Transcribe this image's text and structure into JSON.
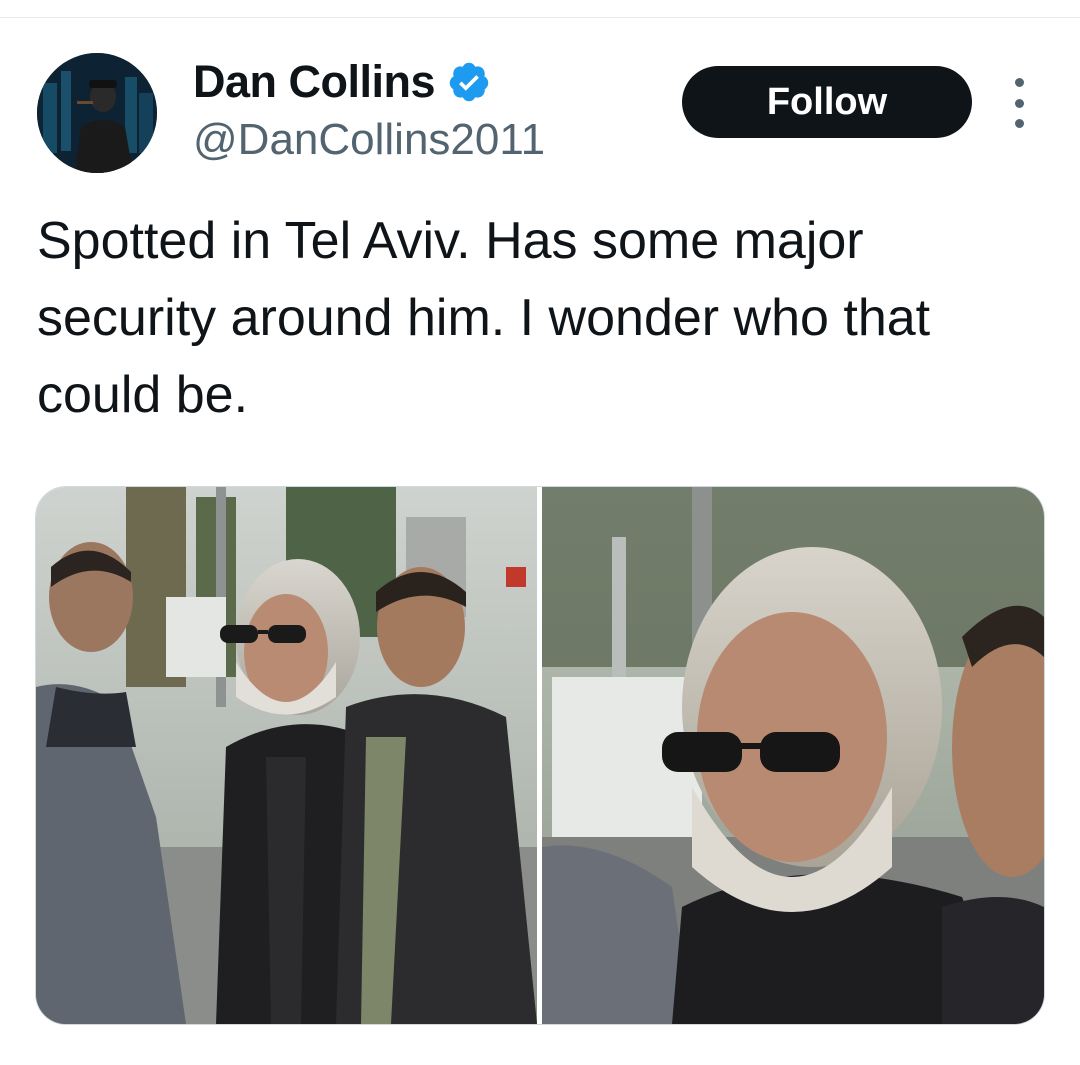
{
  "author": {
    "display_name": "Dan Collins",
    "handle": "@DanCollins2011",
    "avatar_icon": "profile-avatar",
    "verified_icon": "verified-badge-icon",
    "verified_color": "#1d9bf0"
  },
  "actions": {
    "follow_label": "Follow",
    "more_icon": "more-options-icon"
  },
  "tweet": {
    "text": "Spotted in Tel Aviv. Has some major security around him. I wonder who that could be."
  },
  "colors": {
    "text_primary": "#0f1419",
    "text_secondary": "#536471",
    "follow_bg": "#0f1419",
    "follow_text": "#ffffff",
    "background": "#ffffff"
  }
}
